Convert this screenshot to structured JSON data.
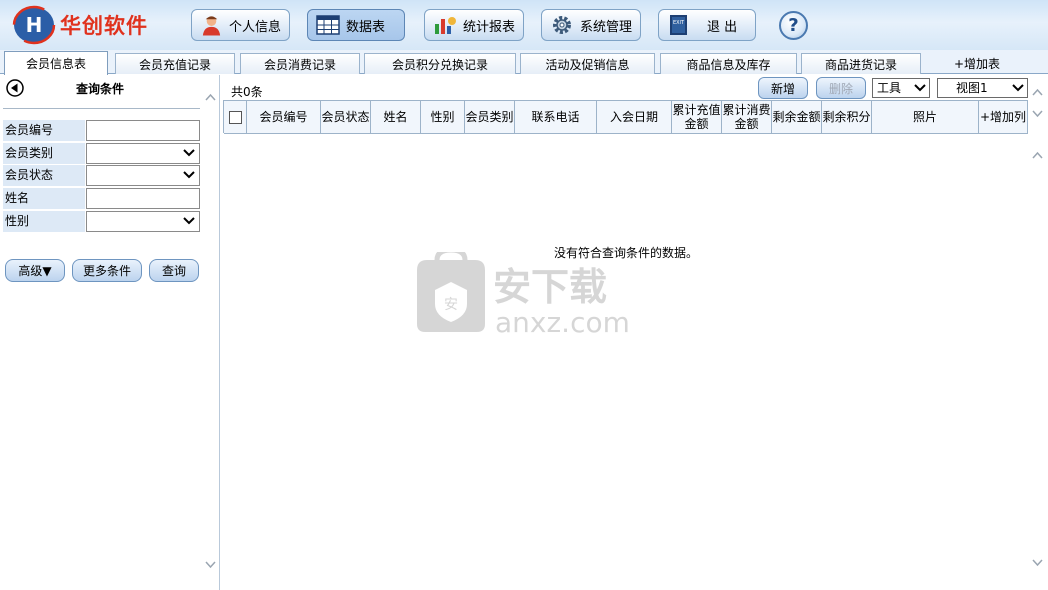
{
  "app": {
    "brand": "华创软件",
    "toolbar": [
      {
        "label": "个人信息",
        "icon": "person-icon"
      },
      {
        "label": "数据表",
        "icon": "table-icon",
        "active": true
      },
      {
        "label": "统计报表",
        "icon": "chart-icon"
      },
      {
        "label": "系统管理",
        "icon": "gear-icon"
      },
      {
        "label": "退  出",
        "icon": "exit-icon"
      }
    ],
    "help": "?"
  },
  "tabs": [
    {
      "label": "会员信息表",
      "active": true
    },
    {
      "label": "会员充值记录"
    },
    {
      "label": "会员消费记录"
    },
    {
      "label": "会员积分兑换记录"
    },
    {
      "label": "活动及促销信息"
    },
    {
      "label": "商品信息及库存"
    },
    {
      "label": "商品进货记录"
    },
    {
      "label": "+增加表"
    }
  ],
  "query": {
    "title": "查询条件",
    "fields": [
      {
        "label": "会员编号",
        "type": "text",
        "value": ""
      },
      {
        "label": "会员类别",
        "type": "select",
        "value": ""
      },
      {
        "label": "会员状态",
        "type": "select",
        "value": ""
      },
      {
        "label": "姓名",
        "type": "text",
        "value": ""
      },
      {
        "label": "性别",
        "type": "select",
        "value": ""
      }
    ],
    "buttons": {
      "advanced": "高级▼",
      "more": "更多条件",
      "search": "查询"
    }
  },
  "main": {
    "count": "共0条",
    "new_label": "新增",
    "delete_label": "删除",
    "tools_value": "工具",
    "view_value": "视图1",
    "columns": [
      "会员编号",
      "会员状态",
      "姓名",
      "性别",
      "会员类别",
      "联系电话",
      "入会日期",
      "累计充值金额",
      "累计消费金额",
      "剩余金额",
      "剩余积分",
      "照片",
      "+增加列"
    ],
    "empty_message": "没有符合查询条件的数据。"
  },
  "watermark": {
    "text_cn": "安下载",
    "text_en": "anxz.com"
  },
  "colors": {
    "brand_red": "#e0321e",
    "accent_blue": "#2b5ea7",
    "label_bg": "#dde9f6"
  }
}
